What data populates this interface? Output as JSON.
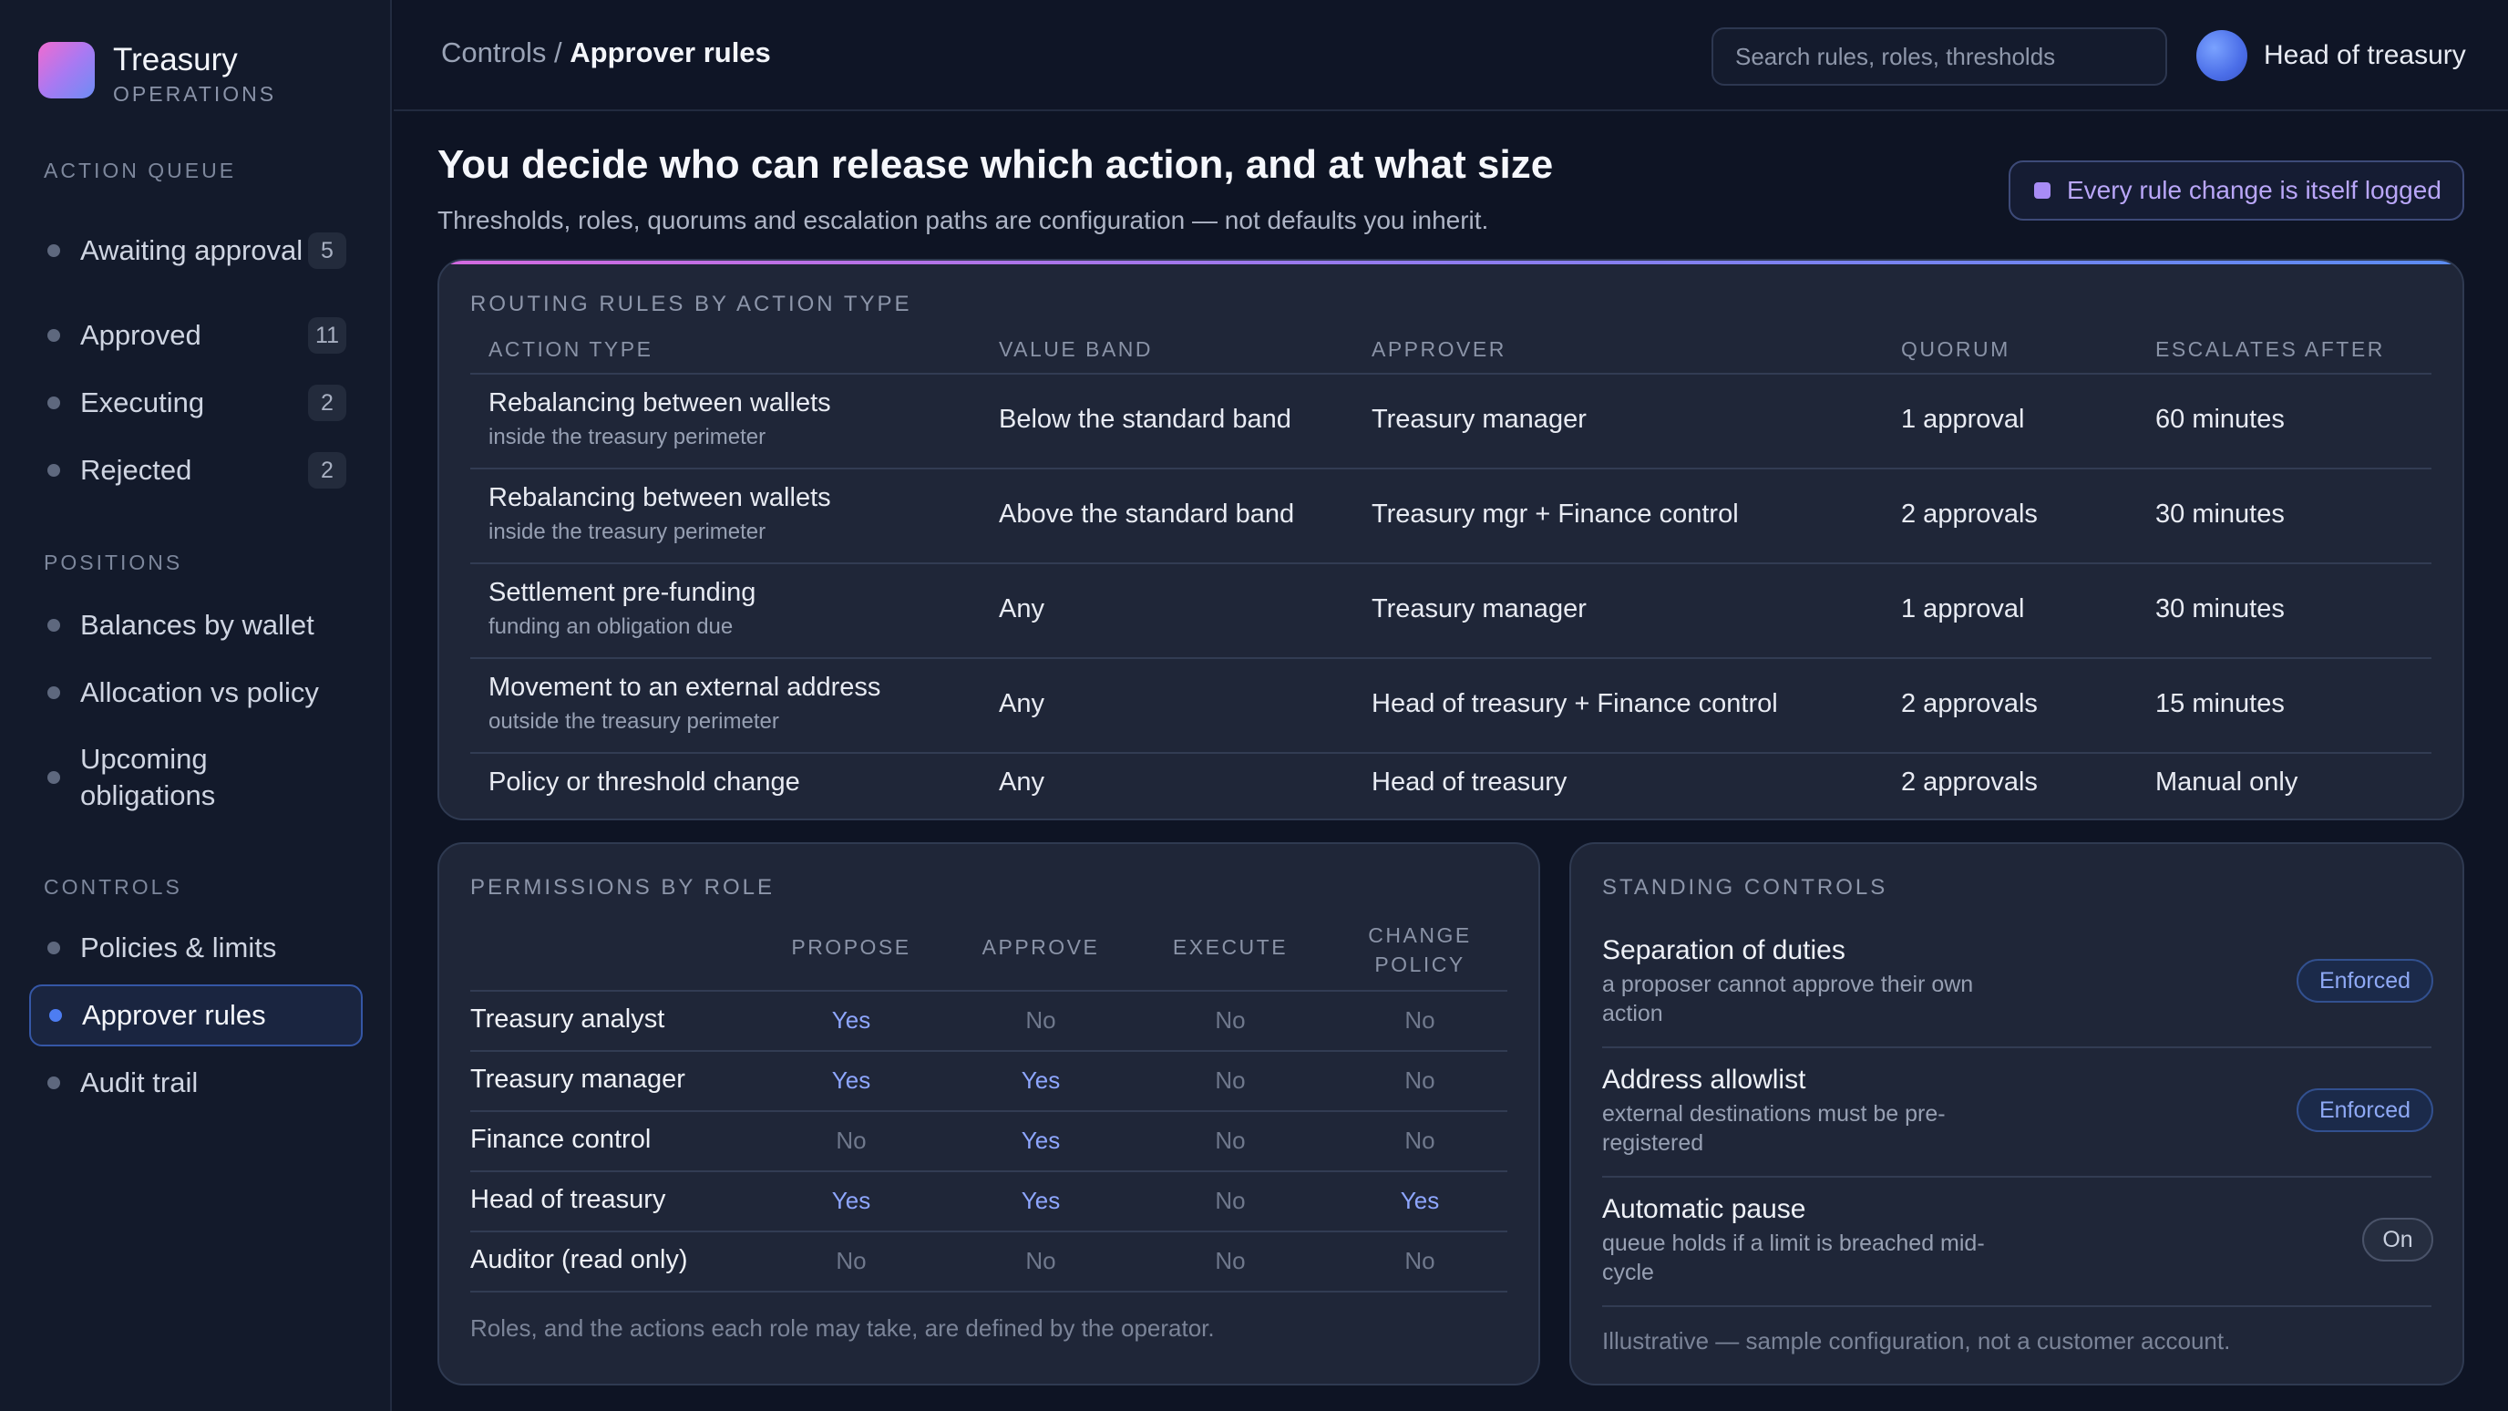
{
  "brand": {
    "title": "Treasury",
    "subtitle": "OPERATIONS"
  },
  "sidebar": {
    "action_queue_label": "ACTION QUEUE",
    "action_queue": [
      {
        "label": "Awaiting approval",
        "count": "5"
      },
      {
        "label": "Approved",
        "count": "11"
      },
      {
        "label": "Executing",
        "count": "2"
      },
      {
        "label": "Rejected",
        "count": "2"
      }
    ],
    "positions_label": "POSITIONS",
    "positions": [
      {
        "label": "Balances by wallet"
      },
      {
        "label": "Allocation vs policy"
      },
      {
        "label": "Upcoming obligations"
      }
    ],
    "controls_label": "CONTROLS",
    "controls": [
      {
        "label": "Policies & limits"
      },
      {
        "label": "Approver rules",
        "active": true
      },
      {
        "label": "Audit trail"
      }
    ]
  },
  "header": {
    "breadcrumb_parent": "Controls",
    "breadcrumb_sep": " / ",
    "breadcrumb_current": "Approver rules",
    "search_placeholder": "Search rules, roles, thresholds",
    "user_name": "Head of treasury"
  },
  "page": {
    "title": "You decide who can release which action, and at what size",
    "subtitle": "Thresholds, roles, quorums and escalation paths are configuration — not defaults you inherit.",
    "log_pill": "Every rule change is itself logged"
  },
  "routing": {
    "label": "ROUTING RULES BY ACTION TYPE",
    "columns": [
      "ACTION TYPE",
      "VALUE BAND",
      "APPROVER",
      "QUORUM",
      "ESCALATES AFTER"
    ],
    "rows": [
      {
        "action": "Rebalancing between wallets",
        "action_sub": "inside the treasury perimeter",
        "band": "Below the standard band",
        "approver": "Treasury manager",
        "quorum": "1 approval",
        "escalates": "60 minutes"
      },
      {
        "action": "Rebalancing between wallets",
        "action_sub": "inside the treasury perimeter",
        "band": "Above the standard band",
        "approver": "Treasury mgr + Finance control",
        "quorum": "2 approvals",
        "escalates": "30 minutes"
      },
      {
        "action": "Settlement pre-funding",
        "action_sub": "funding an obligation due",
        "band": "Any",
        "approver": "Treasury manager",
        "quorum": "1 approval",
        "escalates": "30 minutes"
      },
      {
        "action": "Movement to an external address",
        "action_sub": "outside the treasury perimeter",
        "band": "Any",
        "approver": "Head of treasury + Finance control",
        "quorum": "2 approvals",
        "escalates": "15 minutes"
      },
      {
        "action": "Policy or threshold change",
        "action_sub": "",
        "band": "Any",
        "approver": "Head of treasury",
        "quorum": "2 approvals",
        "escalates": "Manual only"
      }
    ]
  },
  "permissions": {
    "label": "PERMISSIONS BY ROLE",
    "columns": [
      "PROPOSE",
      "APPROVE",
      "EXECUTE",
      "CHANGE POLICY"
    ],
    "rows": [
      {
        "role": "Treasury analyst",
        "values": [
          "Yes",
          "No",
          "No",
          "No"
        ]
      },
      {
        "role": "Treasury manager",
        "values": [
          "Yes",
          "Yes",
          "No",
          "No"
        ]
      },
      {
        "role": "Finance control",
        "values": [
          "No",
          "Yes",
          "No",
          "No"
        ]
      },
      {
        "role": "Head of treasury",
        "values": [
          "Yes",
          "Yes",
          "No",
          "Yes"
        ]
      },
      {
        "role": "Auditor (read only)",
        "values": [
          "No",
          "No",
          "No",
          "No"
        ]
      }
    ],
    "note": "Roles, and the actions each role may take, are defined by the operator."
  },
  "standing": {
    "label": "STANDING CONTROLS",
    "items": [
      {
        "title": "Separation of duties",
        "desc": "a proposer cannot approve their own action",
        "status": "Enforced"
      },
      {
        "title": "Address allowlist",
        "desc": "external destinations must be pre-registered",
        "status": "Enforced"
      },
      {
        "title": "Automatic pause",
        "desc": "queue holds if a limit is breached mid-cycle",
        "status": "On"
      }
    ],
    "note": "Illustrative — sample configuration, not a customer account."
  }
}
